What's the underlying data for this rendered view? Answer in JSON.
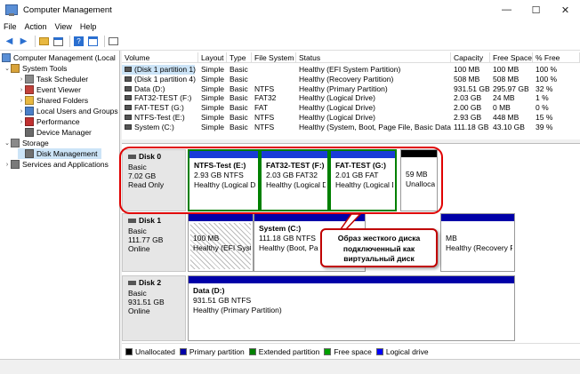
{
  "window": {
    "title": "Computer Management",
    "minimize": "—",
    "maximize": "☐",
    "close": "✕"
  },
  "menu": [
    "File",
    "Action",
    "View",
    "Help"
  ],
  "tree": [
    {
      "label": "Computer Management (Local",
      "icon": "computer-management-icon",
      "level": 0,
      "chev": ""
    },
    {
      "label": "System Tools",
      "icon": "tools-icon",
      "level": 1,
      "chev": "⌄"
    },
    {
      "label": "Task Scheduler",
      "icon": "clock-icon",
      "level": 2,
      "chev": "›"
    },
    {
      "label": "Event Viewer",
      "icon": "event-viewer-icon",
      "level": 2,
      "chev": "›"
    },
    {
      "label": "Shared Folders",
      "icon": "folder-icon",
      "level": 2,
      "chev": "›"
    },
    {
      "label": "Local Users and Groups",
      "icon": "users-icon",
      "level": 2,
      "chev": "›"
    },
    {
      "label": "Performance",
      "icon": "performance-icon",
      "level": 2,
      "chev": "›"
    },
    {
      "label": "Device Manager",
      "icon": "device-manager-icon",
      "level": 2,
      "chev": ""
    },
    {
      "label": "Storage",
      "icon": "storage-icon",
      "level": 1,
      "chev": "⌄"
    },
    {
      "label": "Disk Management",
      "icon": "disk-management-icon",
      "level": 2,
      "chev": "",
      "selected": true
    },
    {
      "label": "Services and Applications",
      "icon": "services-icon",
      "level": 1,
      "chev": "›"
    }
  ],
  "volume_columns": [
    "Volume",
    "Layout",
    "Type",
    "File System",
    "Status",
    "Capacity",
    "Free Space",
    "% Free"
  ],
  "volumes": [
    [
      "(Disk 1 partition 1)",
      "Simple",
      "Basic",
      "",
      "Healthy (EFI System Partition)",
      "100 MB",
      "100 MB",
      "100 %"
    ],
    [
      "(Disk 1 partition 4)",
      "Simple",
      "Basic",
      "",
      "Healthy (Recovery Partition)",
      "508 MB",
      "508 MB",
      "100 %"
    ],
    [
      "Data (D:)",
      "Simple",
      "Basic",
      "NTFS",
      "Healthy (Primary Partition)",
      "931.51 GB",
      "295.97 GB",
      "32 %"
    ],
    [
      "FAT32-TEST (F:)",
      "Simple",
      "Basic",
      "FAT32",
      "Healthy (Logical Drive)",
      "2.03 GB",
      "24 MB",
      "1 %"
    ],
    [
      "FAT-TEST (G:)",
      "Simple",
      "Basic",
      "FAT",
      "Healthy (Logical Drive)",
      "2.00 GB",
      "0 MB",
      "0 %"
    ],
    [
      "NTFS-Test (E:)",
      "Simple",
      "Basic",
      "NTFS",
      "Healthy (Logical Drive)",
      "2.93 GB",
      "448 MB",
      "15 %"
    ],
    [
      "System (C:)",
      "Simple",
      "Basic",
      "NTFS",
      "Healthy (System, Boot, Page File, Basic Data Partition)",
      "111.18 GB",
      "43.10 GB",
      "39 %"
    ]
  ],
  "disks": [
    {
      "name": "Disk 0",
      "type": "Basic",
      "size": "7.02 GB",
      "state": "Read Only",
      "parts": [
        {
          "title": "NTFS-Test  (E:)",
          "line2": "2.93 GB NTFS",
          "line3": "Healthy (Logical D"
        },
        {
          "title": "FAT32-TEST  (F:)",
          "line2": "2.03 GB FAT32",
          "line3": "Healthy (Logical D"
        },
        {
          "title": "FAT-TEST  (G:)",
          "line2": "2.01 GB FAT",
          "line3": "Healthy (Logical D"
        },
        {
          "title": "",
          "line2": "59 MB",
          "line3": "Unalloca"
        }
      ]
    },
    {
      "name": "Disk 1",
      "type": "Basic",
      "size": "111.77 GB",
      "state": "Online",
      "parts": [
        {
          "title": "",
          "line2": "100 MB",
          "line3": "Healthy (EFI Syste"
        },
        {
          "title": "System  (C:)",
          "line2": "111.18 GB NTFS",
          "line3": "Healthy (Boot, Pa"
        },
        {
          "title": "",
          "line2": "MB",
          "line3": "Healthy (Recovery Partitio"
        }
      ]
    },
    {
      "name": "Disk 2",
      "type": "Basic",
      "size": "931.51 GB",
      "state": "Online",
      "parts": [
        {
          "title": "Data  (D:)",
          "line2": "931.51 GB NTFS",
          "line3": "Healthy (Primary Partition)"
        }
      ]
    }
  ],
  "annotation": {
    "line1": "Образ жесткого диска",
    "line2": "подключенный как",
    "line3": "виртуальный диск"
  },
  "legend": [
    {
      "label": "Unallocated",
      "color": "#000000"
    },
    {
      "label": "Primary partition",
      "color": "#0000a8"
    },
    {
      "label": "Extended partition",
      "color": "#008000"
    },
    {
      "label": "Free space",
      "color": "#00a000"
    },
    {
      "label": "Logical drive",
      "color": "#0000ff"
    }
  ],
  "colors": {
    "primary": "#0000a8",
    "logical": "#1a3cd8",
    "extended": "#008000",
    "unallocated": "#000000",
    "selection": "#cce4f7",
    "callout": "#e00000"
  }
}
